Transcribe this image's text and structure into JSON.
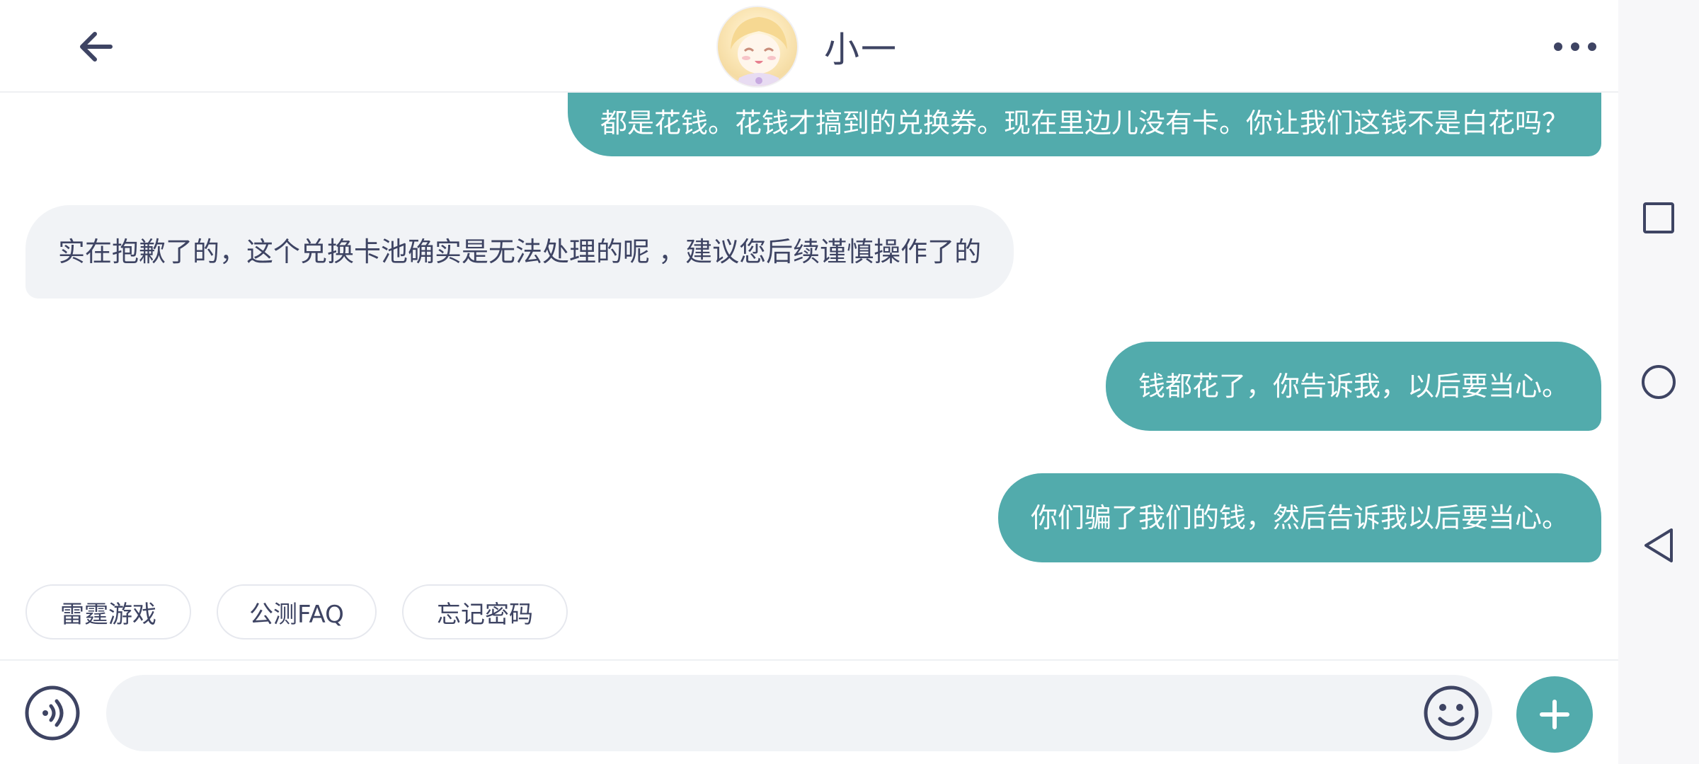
{
  "header": {
    "title": "小一",
    "back_icon": "arrow-left-icon",
    "more_icon": "more-horizontal-icon"
  },
  "messages": [
    {
      "side": "out",
      "text": "都是花钱。花钱才搞到的兑换券。现在里边儿没有卡。你让我们这钱不是白花吗？"
    },
    {
      "side": "in",
      "text": "实在抱歉了的，这个兑换卡池确实是无法处理的呢 ，建议您后续谨慎操作了的"
    },
    {
      "side": "out",
      "text": "钱都花了，你告诉我，以后要当心。"
    },
    {
      "side": "out",
      "text": "你们骗了我们的钱，然后告诉我以后要当心。"
    }
  ],
  "quick_replies": [
    "雷霆游戏",
    "公测FAQ",
    "忘记密码"
  ],
  "composer": {
    "value": "",
    "voice_icon": "voice-icon",
    "emoji_icon": "emoji-icon",
    "plus_icon": "plus-icon"
  },
  "system_nav": [
    "recent-apps-icon",
    "home-icon",
    "back-icon"
  ],
  "colors": {
    "accent": "#52abac",
    "incoming_bubble": "#f1f3f6",
    "text_dark": "#3e4463"
  }
}
